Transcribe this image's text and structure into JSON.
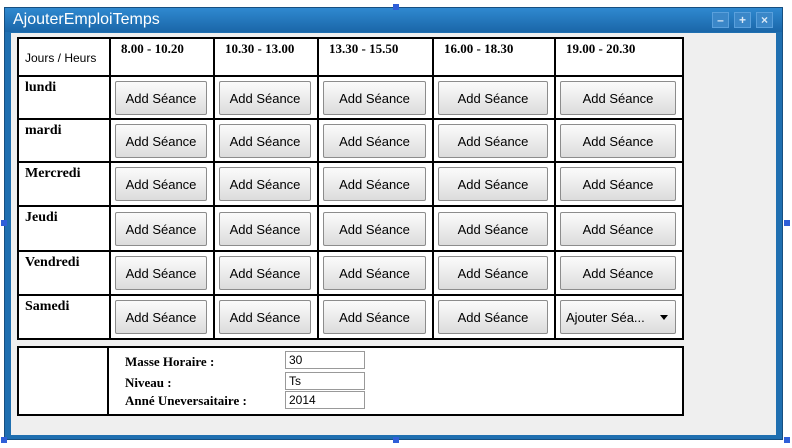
{
  "window": {
    "title": "AjouterEmploiTemps",
    "controls": {
      "minimize": "–",
      "maximize": "+",
      "close": "×"
    }
  },
  "schedule": {
    "corner_label": "Jours / Heurs",
    "time_slots": [
      "8.00  -  10.20",
      "10.30  -  13.00",
      "13.30  -  15.50",
      "16.00  -  18.30",
      "19.00  -  20.30"
    ],
    "days": [
      "lundi",
      "mardi",
      "Mercredi",
      "Jeudi",
      "Vendredi",
      "Samedi"
    ],
    "add_button_label": "Add Séance",
    "last_cell_dropdown_label": "Ajouter Séa..."
  },
  "info": {
    "masse_label": "Masse Horaire :",
    "masse_value": "30",
    "niveau_label": "Niveau :",
    "niveau_value": "Ts",
    "annee_label": "Anné Uneversaitaire :",
    "annee_value": "2014"
  }
}
